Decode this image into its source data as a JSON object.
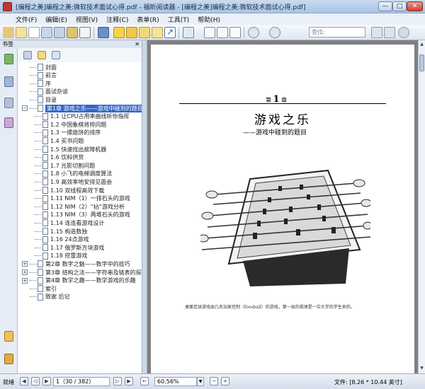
{
  "window": {
    "title": "[编程之美]编程之美:微软技术面试心得.pdf - 福昕阅读器 - [编程之美]编程之美:微软技术面试心得.pdf]",
    "min": "—",
    "max": "□",
    "close": "✕"
  },
  "menu": [
    "文件(F)",
    "编辑(E)",
    "视图(V)",
    "注释(C)",
    "表单(R)",
    "工具(T)",
    "帮助(H)"
  ],
  "toolbar": {
    "search_placeholder": "查找:"
  },
  "sidebar": {
    "header": "书签",
    "close": "✕",
    "bookmarks": [
      {
        "label": "封面",
        "level": 0,
        "expander": ""
      },
      {
        "label": "前言",
        "level": 0,
        "expander": ""
      },
      {
        "label": "序",
        "level": 0,
        "expander": ""
      },
      {
        "label": "面试杂谈",
        "level": 0,
        "expander": ""
      },
      {
        "label": "目录",
        "level": 0,
        "expander": ""
      },
      {
        "label": "第1章 游戏之乐——游戏中碰到的题目",
        "level": 0,
        "expander": "−",
        "selected": true
      },
      {
        "label": "1.1 让CPU占用率曲线听你指挥",
        "level": 1
      },
      {
        "label": "1.2 中国象棋将帅问题",
        "level": 1
      },
      {
        "label": "1.3 一摞烙饼的排序",
        "level": 1
      },
      {
        "label": "1.4 买书问题",
        "level": 1
      },
      {
        "label": "1.5 快速找出故障机器",
        "level": 1
      },
      {
        "label": "1.6 饮料供货",
        "level": 1
      },
      {
        "label": "1.7 光影切割问题",
        "level": 1
      },
      {
        "label": "1.8 小飞的电梯调度算法",
        "level": 1
      },
      {
        "label": "1.9 高效率地安排见面会",
        "level": 1
      },
      {
        "label": "1.10 双线程高效下载",
        "level": 1
      },
      {
        "label": "1.11 NIM（1）一排石头的游戏",
        "level": 1
      },
      {
        "label": "1.12 NIM（2）“拈”游戏分析",
        "level": 1
      },
      {
        "label": "1.13 NIM（3）两堆石头的游戏",
        "level": 1
      },
      {
        "label": "1.14 连连看游戏设计",
        "level": 1
      },
      {
        "label": "1.15 构造数独",
        "level": 1
      },
      {
        "label": "1.16 24点游戏",
        "level": 1
      },
      {
        "label": "1.17 俄罗斯方块游戏",
        "level": 1
      },
      {
        "label": "1.18 挖雷游戏",
        "level": 1
      },
      {
        "label": "第2章 数字之魅——数字中的技巧",
        "level": 0,
        "expander": "+"
      },
      {
        "label": "第3章 结构之法——字符串及链表的探索",
        "level": 0,
        "expander": "+"
      },
      {
        "label": "第4章 数学之趣——数学游戏的乐趣",
        "level": 0,
        "expander": "+"
      },
      {
        "label": "索引",
        "level": 0,
        "expander": ""
      },
      {
        "label": "致谢 后记",
        "level": 0,
        "expander": ""
      }
    ]
  },
  "document": {
    "chapter_prefix": "第",
    "chapter_number": "1",
    "chapter_suffix": "章",
    "chapter_title": "游戏之乐",
    "chapter_subtitle": "——游戏中碰到的题目",
    "caption": "桌面足球游戏由几名玩家控制（foosball）的游戏，第一局的规律是一位大学的学生来的。"
  },
  "status": {
    "ready": "就绪",
    "page_indicator": "1（30 / 382）",
    "zoom": "60.56%",
    "doc_size": "文件: [8.26 * 10.44 英寸]"
  },
  "colors": {
    "accent": "#3367c7",
    "titlebar": "#a9c4e6"
  }
}
